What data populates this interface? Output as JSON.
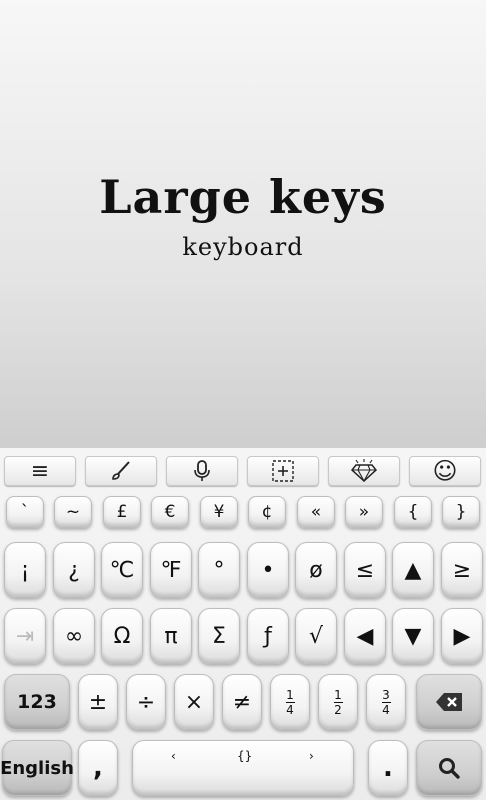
{
  "header": {
    "title": "Large keys",
    "subtitle": "keyboard"
  },
  "toolbar": {
    "icons": [
      "menu-icon",
      "brush-icon",
      "microphone-icon",
      "number-pad-icon",
      "diamond-icon",
      "emoji-icon"
    ],
    "menu": "≡",
    "emoji": "☺"
  },
  "rows": {
    "r1": [
      "`",
      "~",
      "£",
      "€",
      "¥",
      "¢",
      "«",
      "»",
      "{",
      "}"
    ],
    "r2": [
      "¡",
      "¿",
      "℃",
      "℉",
      "°",
      "•",
      "ø",
      "≤",
      "▲",
      "≥"
    ],
    "r3": [
      "⇥",
      "∞",
      "Ω",
      "π",
      "Σ",
      "ƒ",
      "√",
      "◀",
      "▼",
      "▶"
    ],
    "r4": {
      "mode": "123",
      "k1": "±",
      "k2": "÷",
      "k3": "×",
      "k4": "≠",
      "f1_num": "1",
      "f1_den": "4",
      "f2_num": "1",
      "f2_den": "2",
      "f3_num": "3",
      "f3_den": "4"
    },
    "r5": {
      "language": "English",
      "comma": ",",
      "space_left": "‹",
      "space_mid": "{}",
      "space_right": "›",
      "period": "."
    }
  },
  "colors": {
    "accent": "#111111",
    "key_top": "#ffffff",
    "key_bottom": "#dcdcdc",
    "dark_key": "#cfcfcf"
  }
}
